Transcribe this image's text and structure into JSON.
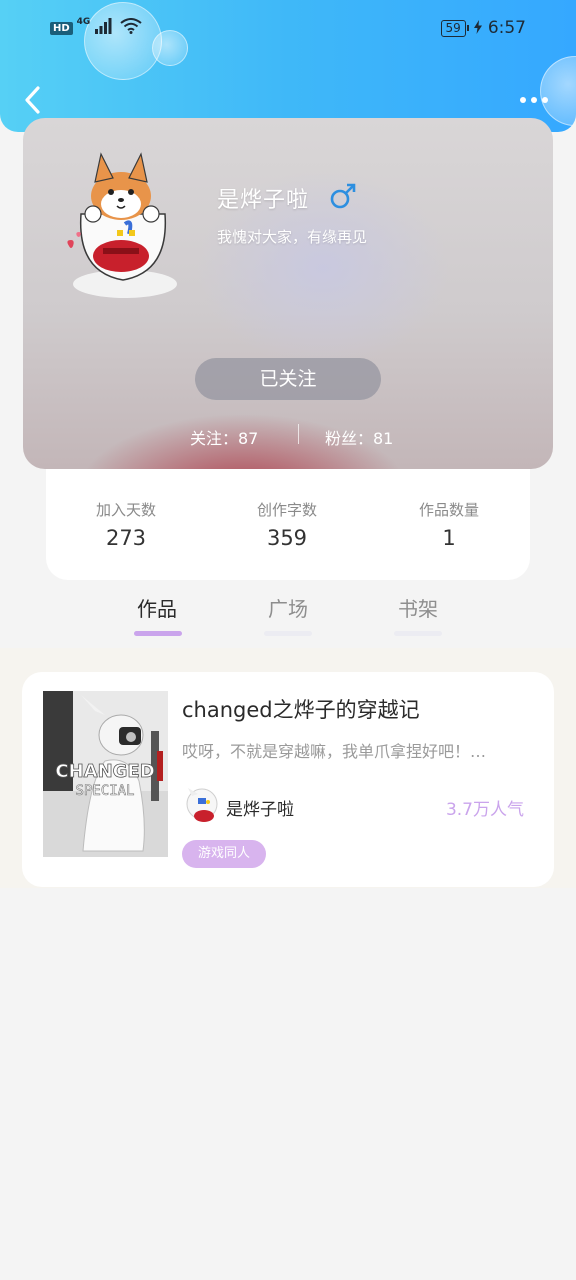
{
  "status_bar": {
    "hd": "HD",
    "network": "4G",
    "battery": "59",
    "time": "6:57"
  },
  "profile": {
    "nickname": "是烨子啦",
    "gender_symbol": "♂",
    "signature": "我愧对大家，有缘再见",
    "follow_button": "已关注",
    "following": "关注：87",
    "fans": "粉丝：81"
  },
  "stats": [
    {
      "label": "加入天数",
      "value": "273"
    },
    {
      "label": "创作字数",
      "value": "359"
    },
    {
      "label": "作品数量",
      "value": "1"
    }
  ],
  "tabs": [
    {
      "label": "作品",
      "active": true
    },
    {
      "label": "广场",
      "active": false
    },
    {
      "label": "书架",
      "active": false
    }
  ],
  "works": [
    {
      "title": "changed之烨子的穿越记",
      "description": "哎呀，不就是穿越嘛，我单爪拿捏好吧！…",
      "author": "是烨子啦",
      "popularity": "3.7万人气",
      "tag": "游戏同人",
      "cover_text_1": "CHANGED",
      "cover_text_2": "SPECIAL"
    }
  ],
  "colors": {
    "header_start": "#56d0f5",
    "header_end": "#35a8ff",
    "accent_purple": "#caa4ec",
    "gender_blue": "#2d8fe0"
  }
}
